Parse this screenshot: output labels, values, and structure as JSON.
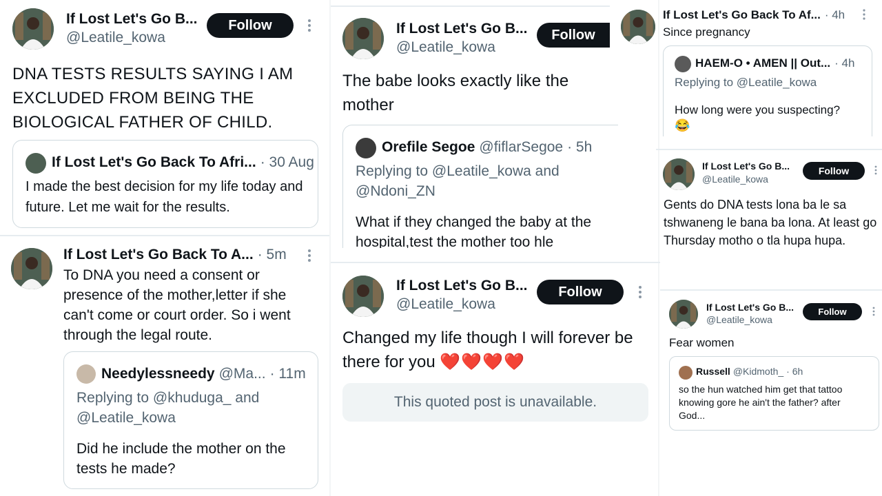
{
  "colors": {
    "accent": "#0f1419",
    "muted": "#536471",
    "border": "#cfd9de",
    "heart": "#e0245e"
  },
  "col1": {
    "post1": {
      "name": "If Lost Let's Go B...",
      "handle": "@Leatile_kowa",
      "follow_label": "Follow",
      "text": "DNA TESTS RESULTS SAYING I AM EXCLUDED FROM BEING THE BIOLOGICAL FATHER OF CHILD.",
      "quote": {
        "name": "If Lost Let's Go Back To Afri...",
        "time": "· 30 Aug",
        "text": "I made the best decision for my life today and future. Let me wait for the results."
      }
    },
    "post2": {
      "name": "If Lost Let's Go Back To A...",
      "time": "· 5m",
      "text": "To DNA you need a consent or presence of the mother,letter if she can't come or court order. So i went through the legal route.",
      "quote": {
        "name": "Needylessneedy",
        "handle": "@Ma...",
        "time": "· 11m",
        "replying": "Replying to @khuduga_ and @Leatile_kowa",
        "text": "Did he include the mother on the tests he made?"
      }
    }
  },
  "col2": {
    "post1": {
      "name": "If Lost Let's Go B...",
      "handle": "@Leatile_kowa",
      "follow_label": "Follow",
      "text": "The babe looks exactly like the mother",
      "quote": {
        "name": "Orefile Segoe",
        "handle": "@fiflarSegoe",
        "time": "· 5h",
        "replying": "Replying to @Leatile_kowa and @Ndoni_ZN",
        "text": "What if they changed the baby at the hospital,test the mother too hle"
      }
    },
    "post2": {
      "name": "If Lost Let's Go B...",
      "handle": "@Leatile_kowa",
      "follow_label": "Follow",
      "text": "Changed my life though I will forever be there for you",
      "hearts": "❤️❤️❤️❤️",
      "unavailable": "This quoted post is unavailable."
    }
  },
  "col3": {
    "post1": {
      "name": "If Lost Let's Go Back To Af...",
      "time": "· 4h",
      "text": "Since pregnancy",
      "quote": {
        "name": "HAEM-O • AMEN || Out...",
        "time": "· 4h",
        "replying": "Replying to @Leatile_kowa",
        "text": "How long were you suspecting?",
        "emoji": "😂"
      }
    },
    "post2": {
      "name": "If Lost Let's Go B...",
      "handle": "@Leatile_kowa",
      "follow_label": "Follow",
      "text": "Gents do DNA tests lona ba le sa tshwaneng le bana ba lona. At least go Thursday motho o tla hupa hupa."
    },
    "post3": {
      "name": "If Lost Let's Go B...",
      "handle": "@Leatile_kowa",
      "follow_label": "Follow",
      "text": "Fear women",
      "quote": {
        "name": "Russell",
        "handle": "@Kidmoth_",
        "time": "· 6h",
        "text": "so the hun watched him get that tattoo knowing gore he ain't the father? after God..."
      }
    }
  }
}
